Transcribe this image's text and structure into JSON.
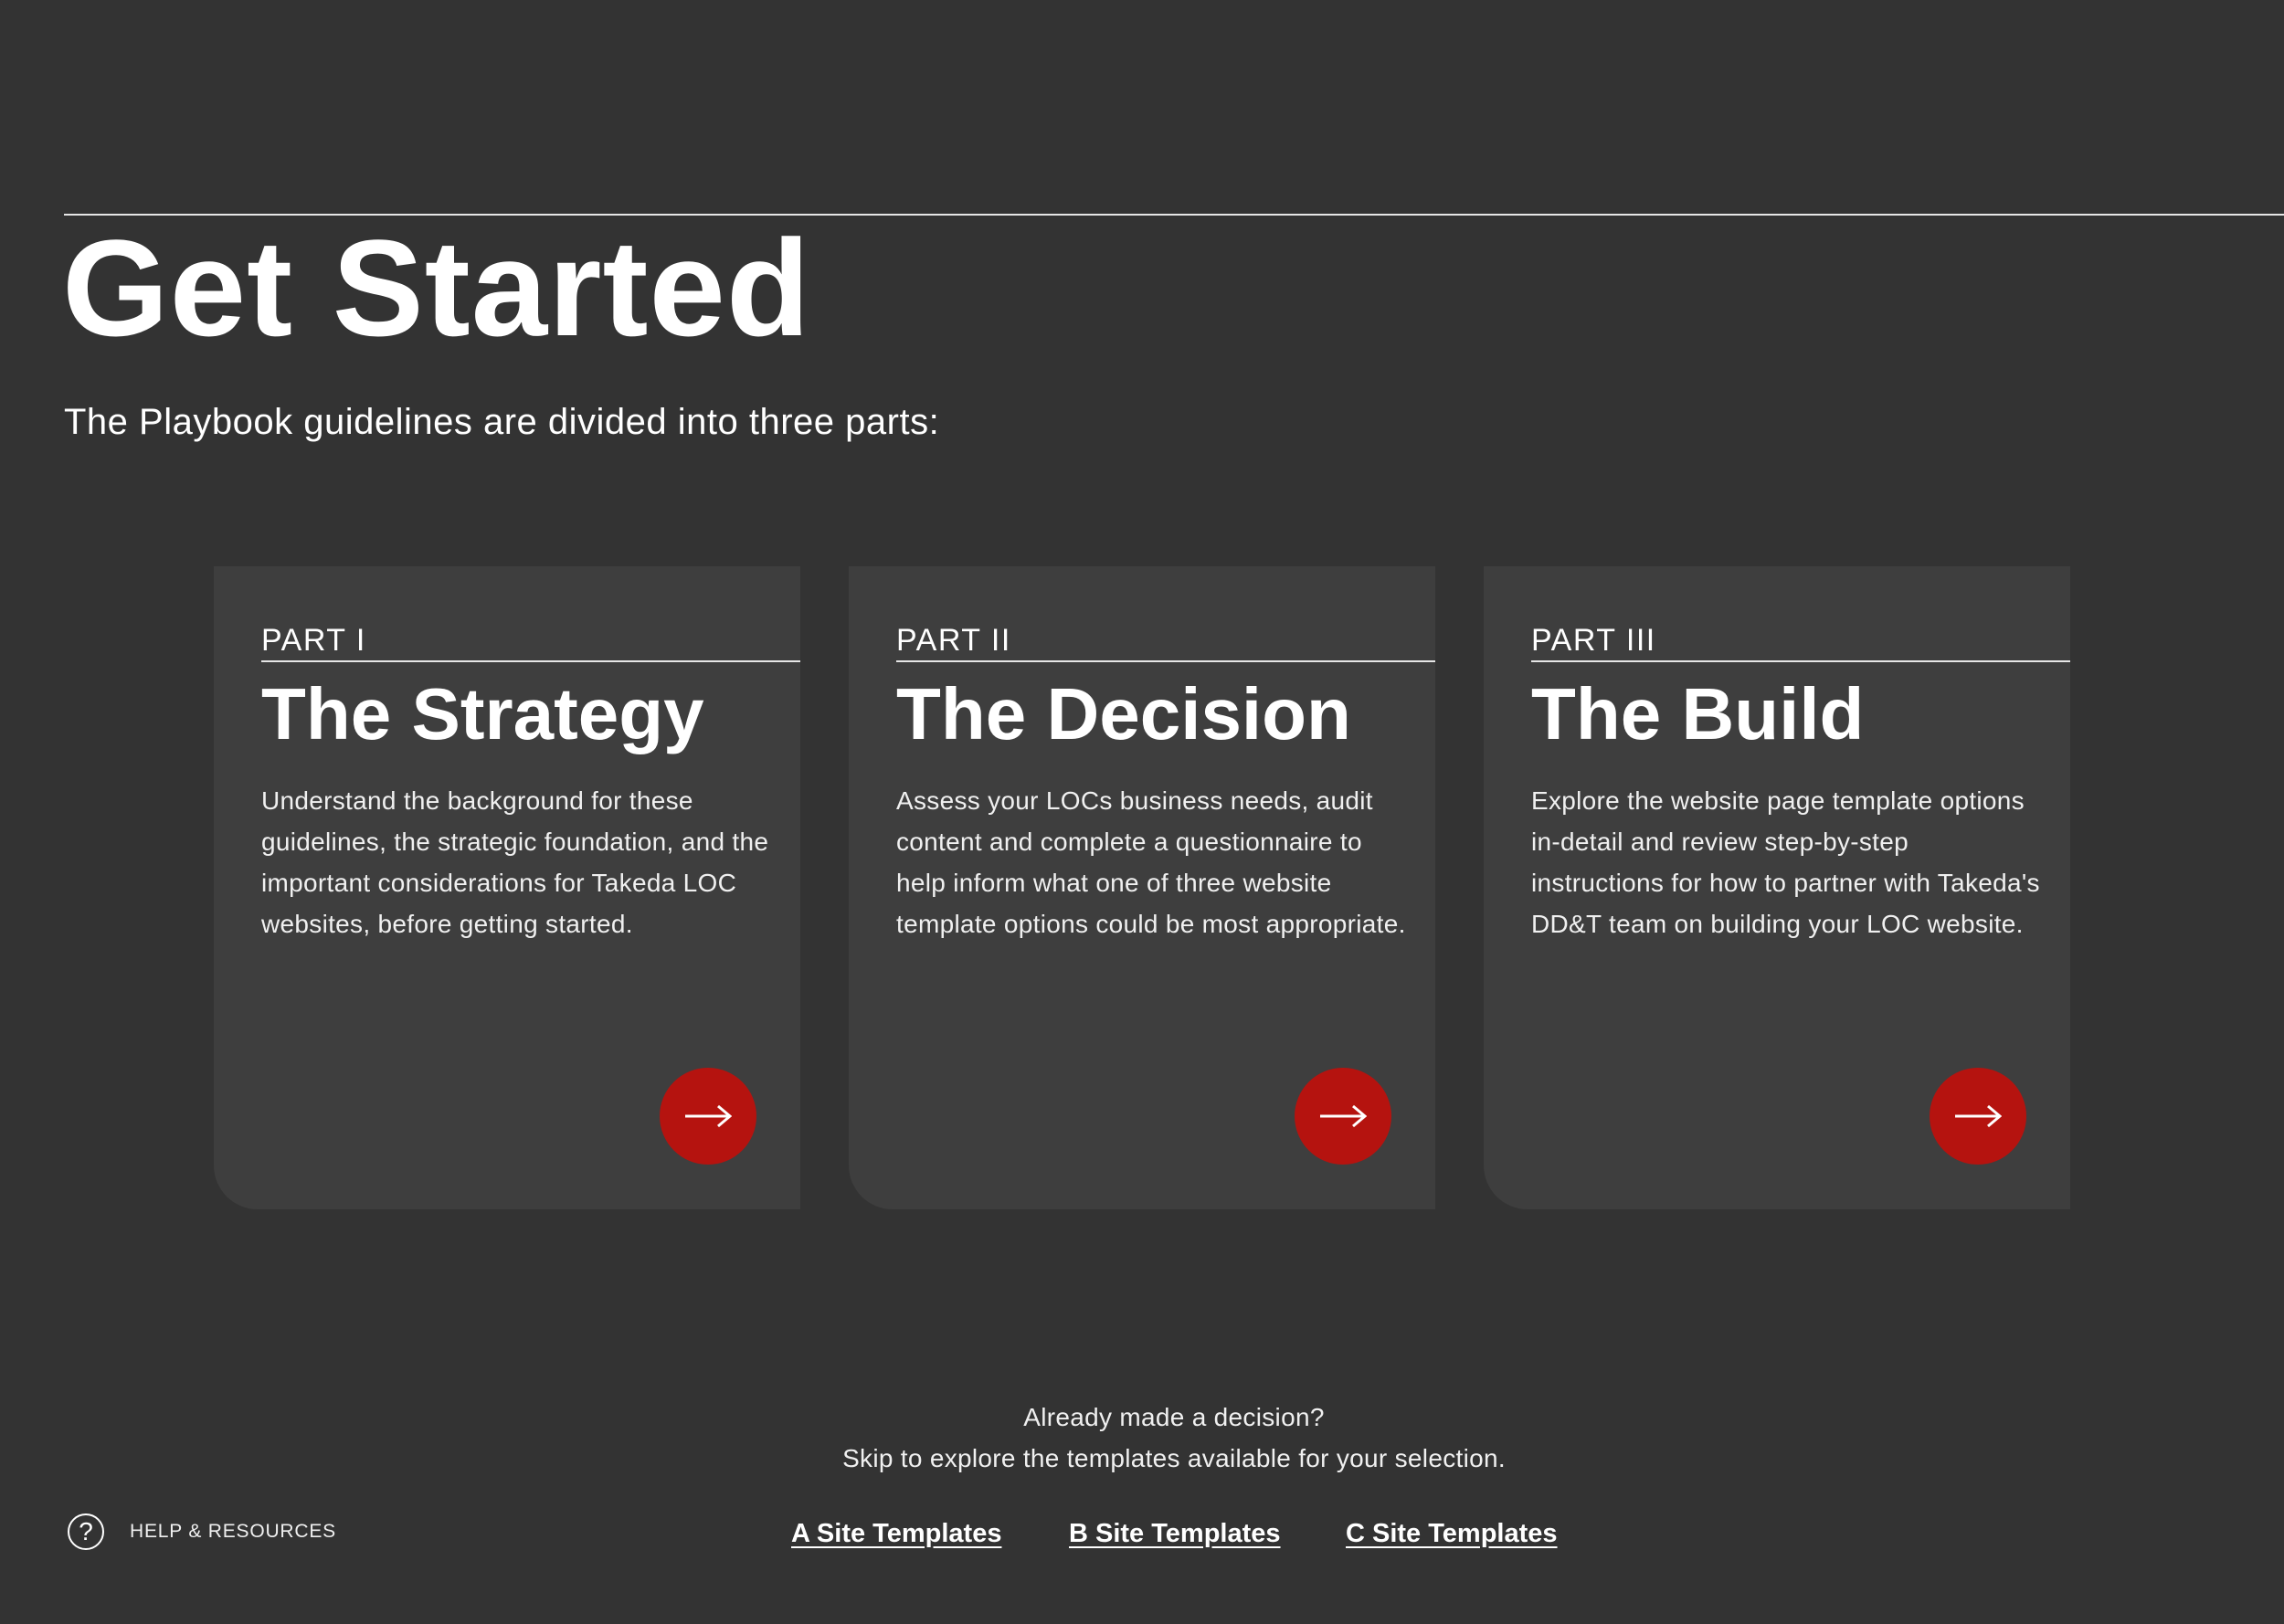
{
  "page": {
    "title": "Get Started",
    "subtitle": "The Playbook guidelines are divided into three parts:"
  },
  "cards": [
    {
      "part": "PART I",
      "heading": "The Strategy",
      "description": "Understand the background for these guidelines, the strategic foundation, and the important considerations for Takeda LOC websites, before getting started.",
      "action_icon": "arrow-right-icon"
    },
    {
      "part": "PART II",
      "heading": "The Decision",
      "description": "Assess your LOCs business needs, audit content and complete a questionnaire to help inform what one of three website template options could be most appropriate.",
      "action_icon": "arrow-right-icon"
    },
    {
      "part": "PART III",
      "heading": "The Build",
      "description": "Explore the website page template options in-detail and review step-by-step instructions for how to partner with Takeda's DD&T team on building your LOC website.",
      "action_icon": "arrow-right-icon"
    }
  ],
  "skip": {
    "line1": "Already made a decision?",
    "line2": "Skip to explore the templates available for your selection."
  },
  "help": {
    "icon": "question-circle-icon",
    "label": "HELP & RESOURCES"
  },
  "template_links": [
    {
      "label": "A Site Templates"
    },
    {
      "label": "B Site Templates"
    },
    {
      "label": "C Site Templates"
    }
  ],
  "colors": {
    "background": "#333333",
    "card_background": "#3e3e3e",
    "accent_red": "#b5130f",
    "text": "#ffffff"
  }
}
